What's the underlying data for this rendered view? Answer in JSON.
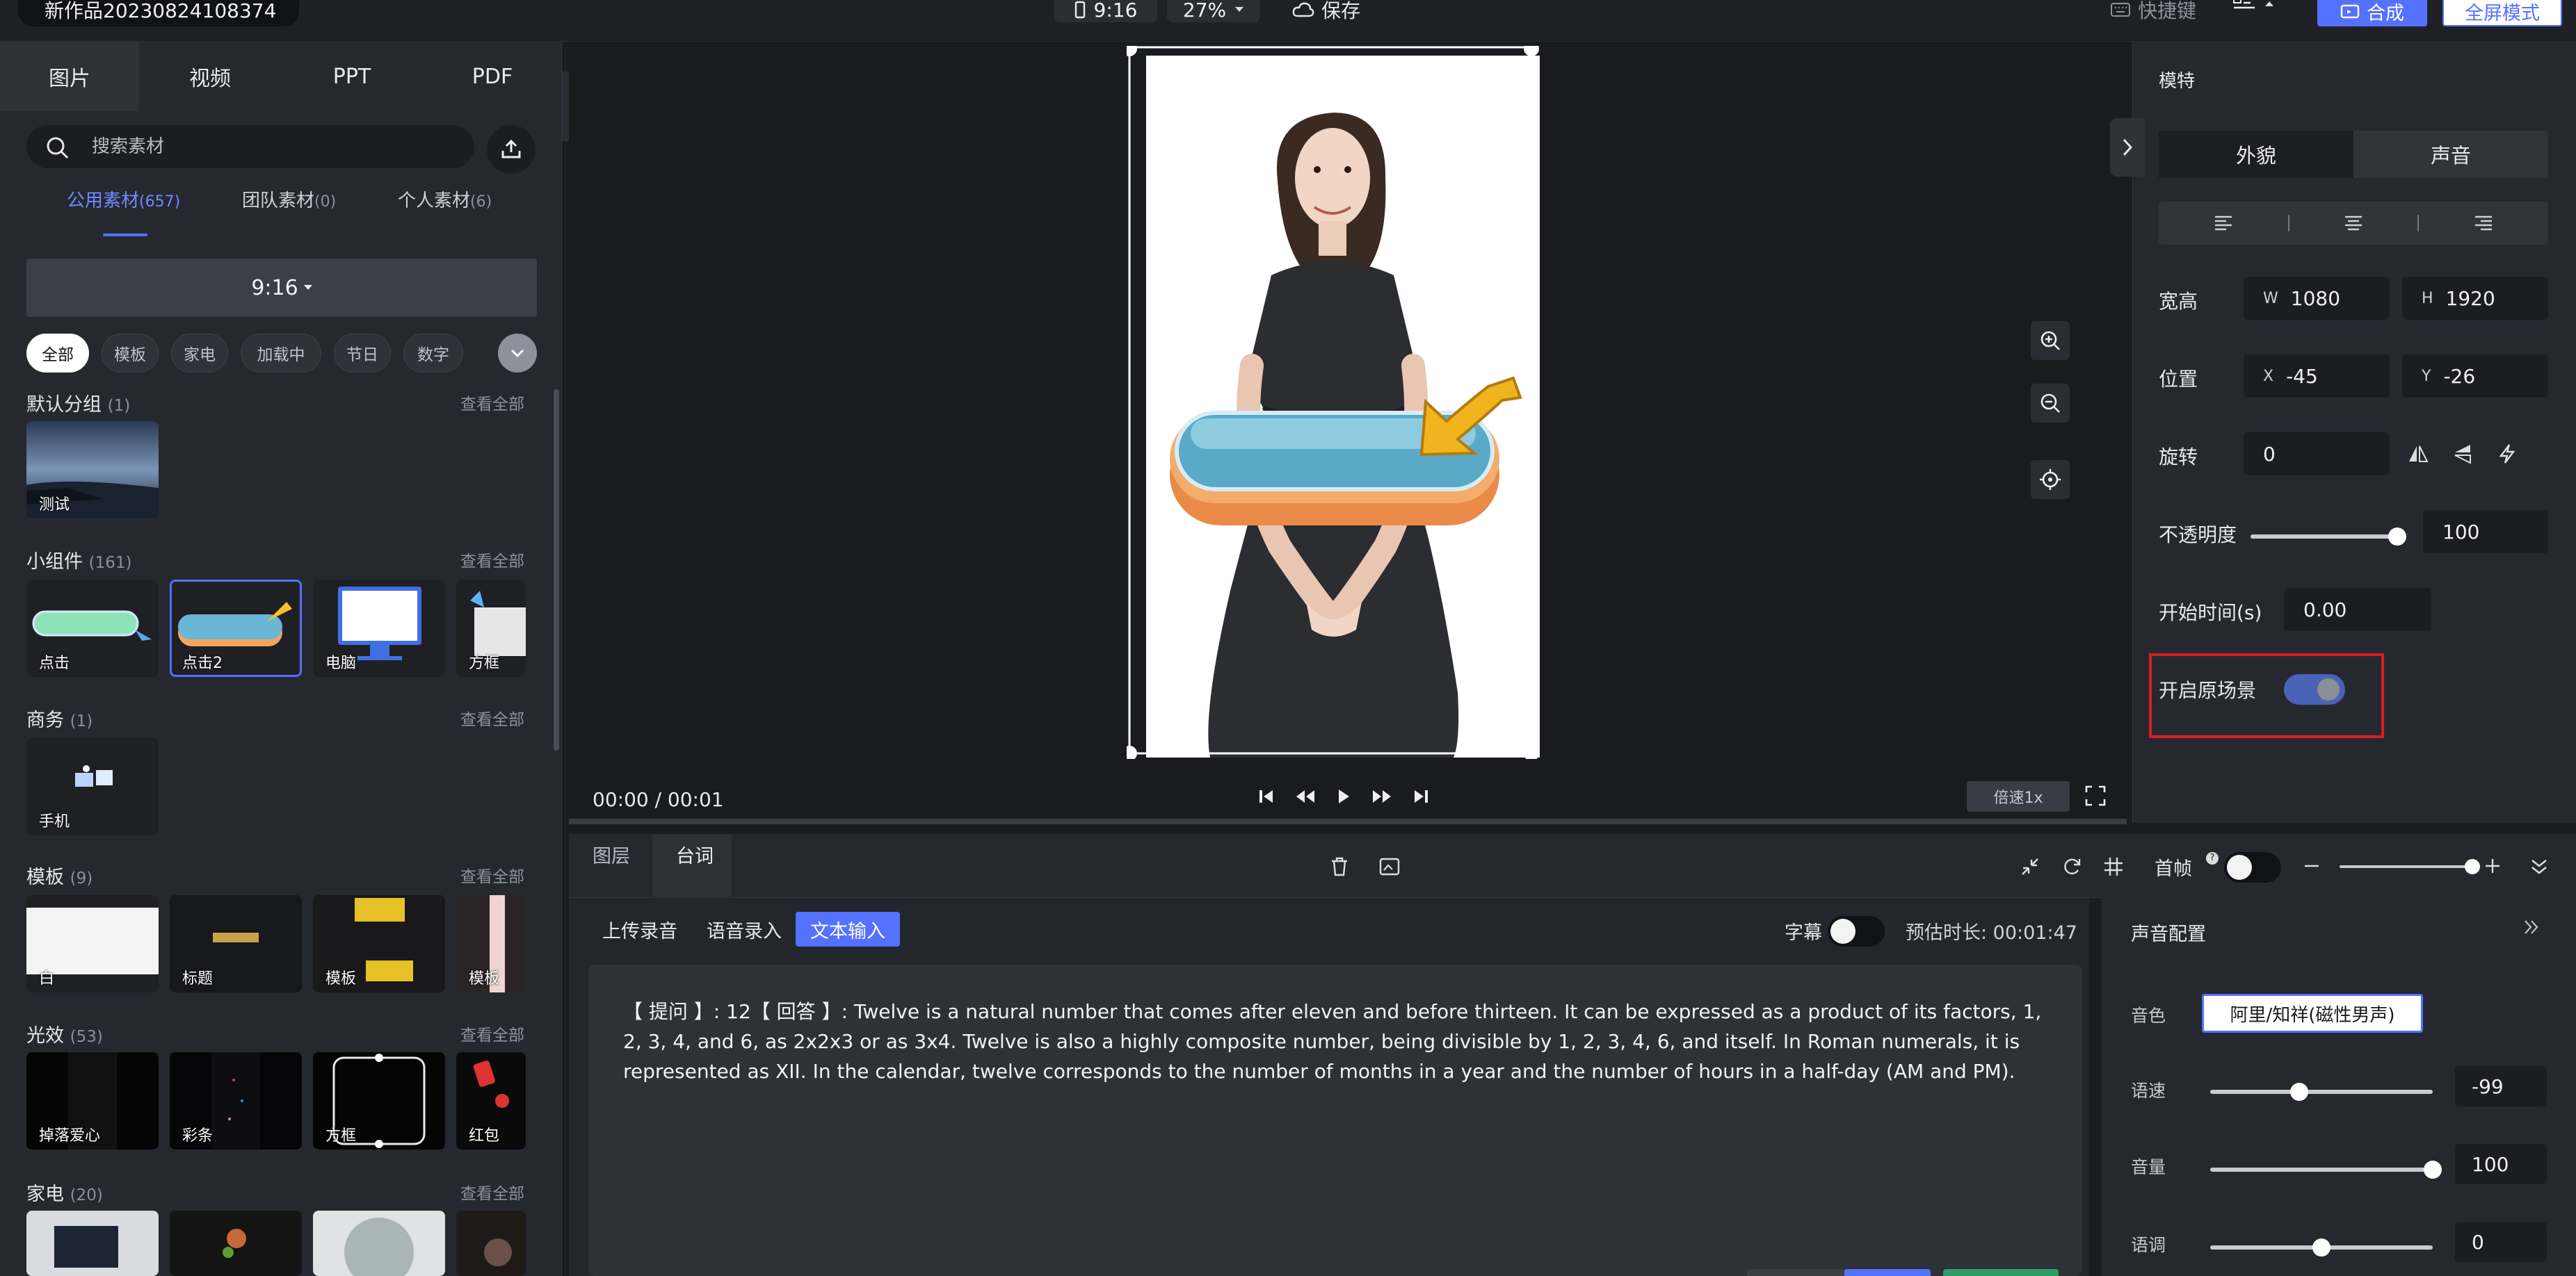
{
  "project": {
    "title": "新作品20230824108374"
  },
  "toolbar": {
    "ratio": "9:16",
    "zoom": "27%",
    "save_label": "保存",
    "shortcut_label": "快捷键",
    "compose_label": "合成",
    "fullscreen_label": "全屏模式"
  },
  "left_panel": {
    "tabs": [
      {
        "label": "图片",
        "active": true
      },
      {
        "label": "视频"
      },
      {
        "label": "PPT"
      },
      {
        "label": "PDF"
      }
    ],
    "search": {
      "placeholder": "搜索素材"
    },
    "subtabs": [
      {
        "label": "公用素材",
        "count": "(657)",
        "active": true
      },
      {
        "label": "团队素材",
        "count": "(0)"
      },
      {
        "label": "个人素材",
        "count": "(6)"
      }
    ],
    "ratio_select": "9:16",
    "chips": [
      "全部",
      "模板",
      "家电",
      "加载中",
      "节日",
      "数字"
    ],
    "see_all": "查看全部",
    "sections": [
      {
        "title": "默认分组",
        "count": "(1)",
        "items": [
          "测试"
        ]
      },
      {
        "title": "小组件",
        "count": "(161)",
        "items": [
          "点击",
          "点击2",
          "电脑",
          "方框"
        ]
      },
      {
        "title": "商务",
        "count": "(1)",
        "items": [
          "手机"
        ]
      },
      {
        "title": "模板",
        "count": "(9)",
        "items": [
          "白",
          "标题",
          "模板",
          "模板"
        ]
      },
      {
        "title": "光效",
        "count": "(53)",
        "items": [
          "掉落爱心",
          "彩条",
          "方框",
          "红包"
        ]
      },
      {
        "title": "家电",
        "count": "(20)",
        "items": []
      }
    ]
  },
  "player": {
    "time": "00:00 / 00:01",
    "speed": "倍速1x"
  },
  "props": {
    "header": "模特",
    "tabs": [
      {
        "label": "外貌",
        "active": true
      },
      {
        "label": "声音"
      }
    ],
    "size_label": "宽高",
    "w_key": "W",
    "w": "1080",
    "h_key": "H",
    "h": "1920",
    "pos_label": "位置",
    "x_key": "X",
    "x": "-45",
    "y_key": "Y",
    "y": "-26",
    "rotate_label": "旋转",
    "rotate": "0",
    "opacity_label": "不透明度",
    "opacity": "100",
    "opacity_fraction": 0.95,
    "start_label": "开始时间(s)",
    "start": "0.00",
    "scene_label": "开启原场景",
    "scene_on": true
  },
  "bottom": {
    "tabs": [
      {
        "label": "图层"
      },
      {
        "label": "台词",
        "active": true
      }
    ],
    "first_frame_label": "首帧",
    "modes": [
      {
        "label": "上传录音"
      },
      {
        "label": "语音录入"
      },
      {
        "label": "文本输入",
        "active": true
      }
    ],
    "subtitle_label": "字幕",
    "duration_label": "预估时长: 00:01:47",
    "script_text": "【 提问 】: 12【 回答 】: Twelve is a natural number that comes after eleven and before thirteen. It can be expressed as a product of its factors, 1, 2, 3, 4, and 6, as 2x2x3 or as 3x4. Twelve is also a highly composite number, being divisible by 1, 2, 3, 4, 6, and itself. In Roman numerals, it is represented as XII. In the calendar, twelve corresponds to the number of months in a year and the number of hours in a half-day (AM and PM)."
  },
  "voice": {
    "header": "声音配置",
    "timbre_label": "音色",
    "timbre": "阿里/知祥(磁性男声)",
    "speed_label": "语速",
    "speed": "-99",
    "speed_fraction": 0.4,
    "volume_label": "音量",
    "volume": "100",
    "volume_fraction": 1.0,
    "pitch_label": "语调",
    "pitch": "0",
    "pitch_fraction": 0.5
  },
  "colors": {
    "accent": "#5471ff",
    "highlight": "#d81e22",
    "toggle_on": "#4a62b8"
  }
}
